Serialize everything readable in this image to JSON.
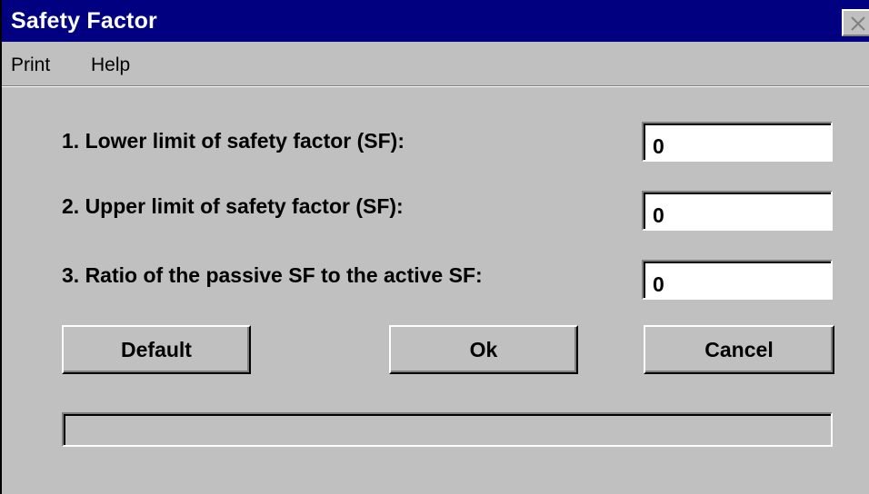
{
  "window": {
    "title": "Safety Factor"
  },
  "menu": {
    "items": [
      {
        "label": "Print"
      },
      {
        "label": "Help"
      }
    ]
  },
  "fields": [
    {
      "label": "1. Lower limit of safety factor (SF):",
      "value": "0"
    },
    {
      "label": "2. Upper limit of safety factor (SF):",
      "value": "0"
    },
    {
      "label": "3. Ratio of the passive SF to the active SF:",
      "value": "0"
    }
  ],
  "buttons": {
    "default_label": "Default",
    "ok_label": "Ok",
    "cancel_label": "Cancel"
  },
  "status": {
    "text": ""
  },
  "icons": {
    "close": "close-icon"
  }
}
